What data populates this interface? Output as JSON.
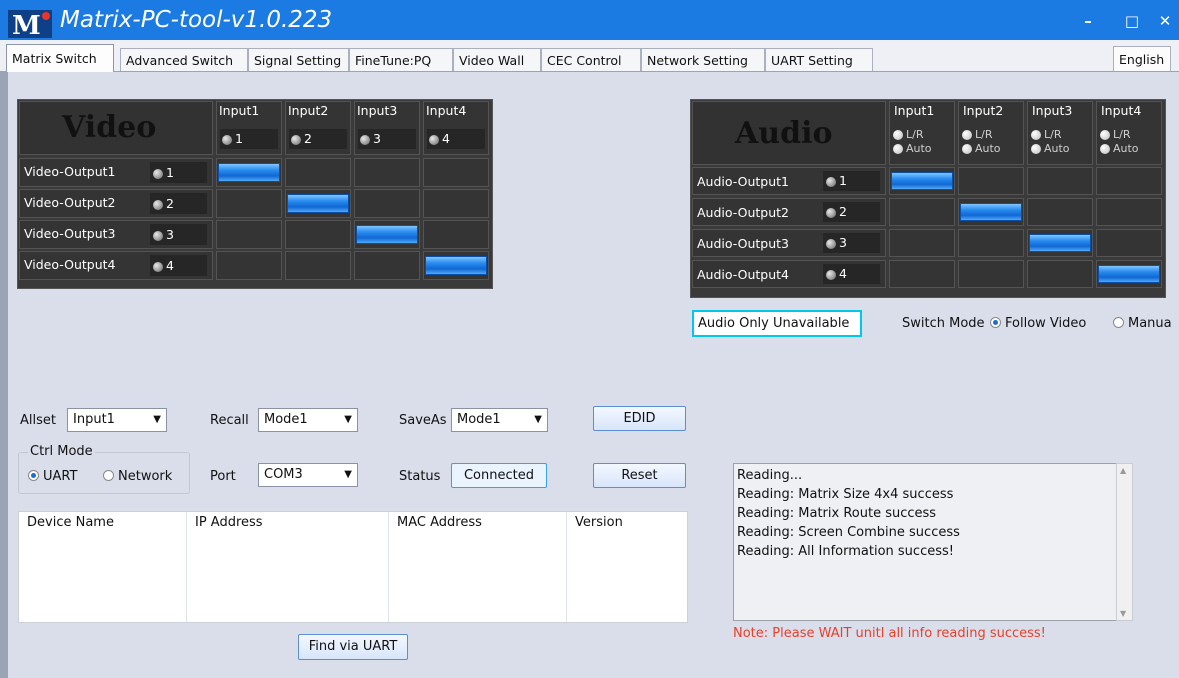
{
  "window": {
    "title": "Matrix-PC-tool-v1.0.223",
    "logo_text": "M",
    "controls": {
      "minimize": "–",
      "maximize": "□",
      "close": "✕"
    }
  },
  "tabs": [
    {
      "label": "Matrix Switch",
      "active": true
    },
    {
      "label": "Advanced Switch"
    },
    {
      "label": "Signal Setting"
    },
    {
      "label": "FineTune:PQ"
    },
    {
      "label": "Video Wall"
    },
    {
      "label": "CEC Control"
    },
    {
      "label": "Network Setting"
    },
    {
      "label": "UART Setting"
    }
  ],
  "language_button": "English",
  "video_matrix": {
    "title": "Video",
    "inputs": [
      {
        "label": "Input1",
        "num": "1"
      },
      {
        "label": "Input2",
        "num": "2"
      },
      {
        "label": "Input3",
        "num": "3"
      },
      {
        "label": "Input4",
        "num": "4"
      }
    ],
    "outputs": [
      {
        "label": "Video-Output1",
        "num": "1",
        "selected_input": 1
      },
      {
        "label": "Video-Output2",
        "num": "2",
        "selected_input": 2
      },
      {
        "label": "Video-Output3",
        "num": "3",
        "selected_input": 3
      },
      {
        "label": "Video-Output4",
        "num": "4",
        "selected_input": 4
      }
    ]
  },
  "audio_matrix": {
    "title": "Audio",
    "inputs": [
      {
        "label": "Input1",
        "opt1": "L/R",
        "opt2": "Auto"
      },
      {
        "label": "Input2",
        "opt1": "L/R",
        "opt2": "Auto"
      },
      {
        "label": "Input3",
        "opt1": "L/R",
        "opt2": "Auto"
      },
      {
        "label": "Input4",
        "opt1": "L/R",
        "opt2": "Auto"
      }
    ],
    "outputs": [
      {
        "label": "Audio-Output1",
        "num": "1",
        "selected_input": 1
      },
      {
        "label": "Audio-Output2",
        "num": "2",
        "selected_input": 2
      },
      {
        "label": "Audio-Output3",
        "num": "3",
        "selected_input": 3
      },
      {
        "label": "Audio-Output4",
        "num": "4",
        "selected_input": 4
      }
    ]
  },
  "audio_only_button": "Audio Only Unavailable",
  "switch_mode": {
    "label": "Switch Mode",
    "opt_follow": "Follow Video",
    "opt_manual": "Manua",
    "selected": "Follow Video"
  },
  "controls": {
    "allset_label": "Allset",
    "allset_value": "Input1",
    "recall_label": "Recall",
    "recall_value": "Mode1",
    "saveas_label": "SaveAs",
    "saveas_value": "Mode1",
    "edid_button": "EDID",
    "ctrl_mode_label": "Ctrl Mode",
    "uart_label": "UART",
    "network_label": "Network",
    "ctrl_selected": "UART",
    "port_label": "Port",
    "port_value": "COM3",
    "status_label": "Status",
    "status_value": "Connected",
    "reset_button": "Reset",
    "find_button": "Find via UART"
  },
  "device_table": {
    "columns": [
      "Device Name",
      "IP Address",
      "MAC Address",
      "Version"
    ],
    "rows": []
  },
  "log": [
    "Reading...",
    "Reading: Matrix Size 4x4 success",
    "Reading: Matrix Route success",
    "Reading: Screen Combine success",
    "Reading: All Information success!"
  ],
  "note": "Note: Please WAIT unitl all info reading success!",
  "colors": {
    "titlebar": "#1c7be3",
    "note": "#e8402a",
    "selected_cell": "#1a7fe6",
    "highlight_border": "#00c8e8"
  }
}
